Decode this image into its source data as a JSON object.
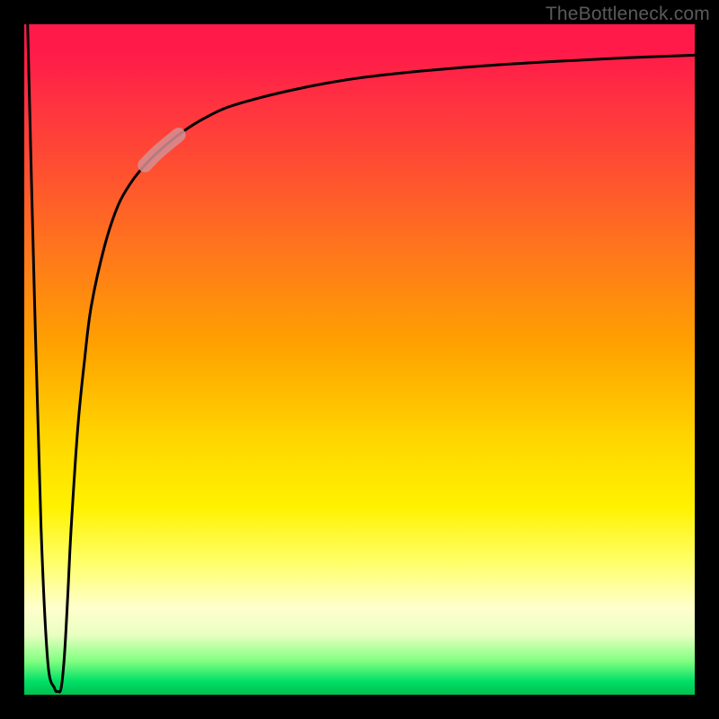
{
  "attribution": "TheBottleneck.com",
  "chart_data": {
    "type": "line",
    "title": "",
    "xlabel": "",
    "ylabel": "",
    "xlim": [
      0,
      100
    ],
    "ylim": [
      0,
      100
    ],
    "grid": false,
    "legend": false,
    "series": [
      {
        "name": "bottleneck-curve",
        "x": [
          0.5,
          1.5,
          2.5,
          3.5,
          4.5,
          5,
          5.5,
          6,
          6.5,
          7,
          8,
          9,
          10,
          12,
          14,
          16,
          18,
          20,
          23,
          26,
          30,
          35,
          40,
          45,
          50,
          55,
          60,
          70,
          80,
          90,
          100
        ],
        "y": [
          100,
          60,
          25,
          5,
          1,
          0.5,
          1,
          6,
          15,
          25,
          40,
          50,
          58,
          67,
          73,
          76.5,
          79,
          81,
          83.5,
          85.5,
          87.5,
          89,
          90.2,
          91.2,
          92,
          92.6,
          93.1,
          93.9,
          94.5,
          95,
          95.4
        ]
      }
    ],
    "highlight_segment": {
      "series": "bottleneck-curve",
      "x_start": 18,
      "x_end": 23,
      "color": "#d68f93",
      "opacity": 0.85
    },
    "background_gradient": {
      "orientation": "vertical",
      "stops": [
        {
          "pos": 0.0,
          "color": "#ff1a4a"
        },
        {
          "pos": 0.35,
          "color": "#ff7a1a"
        },
        {
          "pos": 0.62,
          "color": "#ffd600"
        },
        {
          "pos": 0.8,
          "color": "#ffff66"
        },
        {
          "pos": 0.95,
          "color": "#80ff80"
        },
        {
          "pos": 1.0,
          "color": "#00c050"
        }
      ]
    }
  }
}
